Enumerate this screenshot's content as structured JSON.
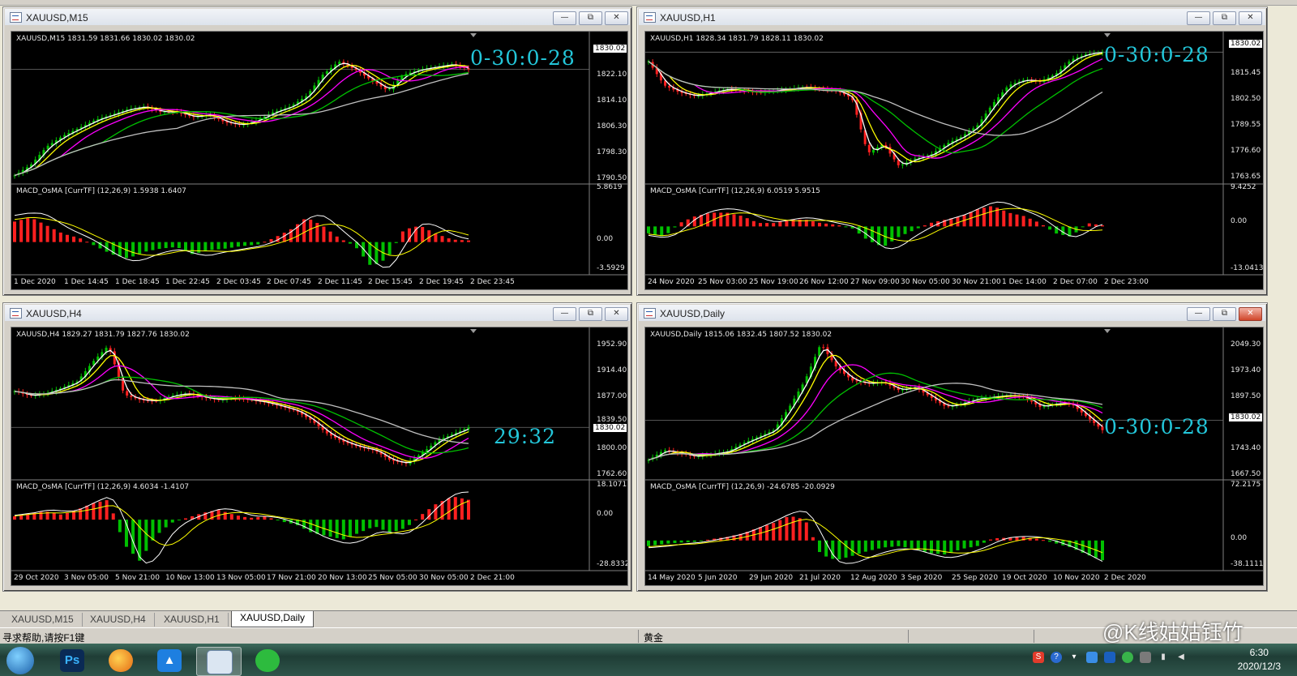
{
  "charts": [
    {
      "title": "XAUUSD,M15",
      "main_info": "XAUUSD,M15  1831.59 1831.66 1830.02 1830.02",
      "macd_info": "MACD_OsMA [CurrTF] (12,26,9) 1.5938 1.6407",
      "current_price": "1830.02",
      "overlay_text": "0-30:0-28",
      "price_ticks": [
        "1822.10",
        "1814.10",
        "1806.30",
        "1798.30",
        "1790.50"
      ],
      "macd_ticks": [
        "5.8619",
        "0.00",
        "-3.5929"
      ],
      "time_ticks": [
        "1 Dec 2020",
        "1 Dec 14:45",
        "1 Dec 18:45",
        "1 Dec 22:45",
        "2 Dec 03:45",
        "2 Dec 07:45",
        "2 Dec 11:45",
        "2 Dec 15:45",
        "2 Dec 19:45",
        "2 Dec 23:45"
      ],
      "price_range": [
        1788,
        1840
      ],
      "price_trend": [
        1790,
        1794,
        1801,
        1805,
        1808,
        1811,
        1813,
        1815,
        1816,
        1814,
        1814,
        1812,
        1813,
        1810,
        1809,
        1811,
        1814,
        1816,
        1820,
        1828,
        1833,
        1830,
        1826,
        1822,
        1828,
        1830,
        1831,
        1832,
        1830
      ],
      "macd_range": [
        -3.6,
        5.9
      ],
      "macd_hist": [
        2.5,
        3,
        2,
        1,
        0.5,
        -0.5,
        -1.5,
        -2,
        -1.2,
        -0.8,
        -0.6,
        -1.5,
        -1,
        -0.8,
        -0.5,
        -0.3,
        0.5,
        1.5,
        3,
        2,
        0.5,
        -0.5,
        -3,
        -2,
        1.5,
        2,
        1,
        0.3,
        0.2
      ]
    },
    {
      "title": "XAUUSD,H1",
      "main_info": "XAUUSD,H1  1828.34 1831.79 1828.11 1830.02",
      "macd_info": "MACD_OsMA [CurrTF] (12,26,9) 6.0519 5.9515",
      "current_price": "1830.02",
      "overlay_text": "0-30:0-28",
      "price_ticks": [
        "1815.45",
        "1802.50",
        "1789.55",
        "1776.60",
        "1763.65"
      ],
      "macd_ticks": [
        "9.4252",
        "0.00",
        "-13.0413"
      ],
      "time_ticks": [
        "24 Nov 2020",
        "25 Nov 03:00",
        "25 Nov 19:00",
        "26 Nov 12:00",
        "27 Nov 09:00",
        "30 Nov 05:00",
        "30 Nov 21:00",
        "1 Dec 14:00",
        "2 Dec 07:00",
        "2 Dec 23:00"
      ],
      "price_range": [
        1760,
        1835
      ],
      "price_trend": [
        1825,
        1812,
        1808,
        1806,
        1808,
        1810,
        1809,
        1808,
        1809,
        1810,
        1811,
        1810,
        1809,
        1805,
        1775,
        1780,
        1768,
        1772,
        1774,
        1780,
        1784,
        1790,
        1802,
        1812,
        1815,
        1814,
        1818,
        1826,
        1829,
        1830
      ],
      "macd_range": [
        -13.1,
        9.5
      ],
      "macd_hist": [
        -2,
        -3,
        1,
        3,
        4,
        4,
        3,
        1,
        1,
        2,
        2,
        1,
        0.5,
        -0.5,
        -4,
        -6,
        -3,
        -1,
        1,
        2,
        3,
        5,
        6,
        4,
        3,
        1,
        -2,
        -3,
        1,
        0.3
      ]
    },
    {
      "title": "XAUUSD,H4",
      "main_info": "XAUUSD,H4  1829.27 1831.79 1827.76 1830.02",
      "macd_info": "MACD_OsMA [CurrTF] (12,26,9) 4.6034 -1.4107",
      "current_price": "1830.02",
      "overlay_text": "29:32",
      "price_ticks": [
        "1952.90",
        "1914.40",
        "1877.00",
        "1839.50",
        "1800.00",
        "1762.60"
      ],
      "macd_ticks": [
        "18.1071",
        "0.00",
        "-28.8332"
      ],
      "time_ticks": [
        "29 Oct 2020",
        "3 Nov 05:00",
        "5 Nov 21:00",
        "10 Nov 13:00",
        "13 Nov 05:00",
        "17 Nov 21:00",
        "20 Nov 13:00",
        "25 Nov 05:00",
        "30 Nov 05:00",
        "2 Dec 21:00"
      ],
      "price_range": [
        1755,
        1965
      ],
      "price_trend": [
        1885,
        1878,
        1882,
        1890,
        1900,
        1930,
        1955,
        1880,
        1872,
        1870,
        1878,
        1882,
        1876,
        1872,
        1875,
        1872,
        1868,
        1862,
        1855,
        1840,
        1820,
        1808,
        1800,
        1795,
        1780,
        1775,
        1790,
        1810,
        1820,
        1830
      ],
      "macd_range": [
        -28.9,
        18.2
      ],
      "macd_hist": [
        2,
        4,
        5,
        3,
        6,
        10,
        12,
        -15,
        -25,
        -10,
        -2,
        1,
        4,
        6,
        3,
        1,
        2,
        -1,
        -3,
        -8,
        -10,
        -12,
        -8,
        -4,
        -8,
        -5,
        3,
        10,
        14,
        12
      ]
    },
    {
      "title": "XAUUSD,Daily",
      "main_info": "XAUUSD,Daily  1815.06 1832.45 1807.52 1830.02",
      "macd_info": "MACD_OsMA [CurrTF] (12,26,9) -24.6785 -20.0929",
      "current_price": "1830.02",
      "overlay_text": "0-30:0-28",
      "price_ticks": [
        "2049.30",
        "1973.40",
        "1897.50",
        "1830.02",
        "1743.40",
        "1667.50"
      ],
      "macd_ticks": [
        "72.2175",
        "0.00",
        "-38.1111"
      ],
      "time_ticks": [
        "14 May 2020",
        "5 Jun 2020",
        "29 Jun 2020",
        "21 Jul 2020",
        "12 Aug 2020",
        "3 Sep 2020",
        "25 Sep 2020",
        "19 Oct 2020",
        "10 Nov 2020",
        "2 Dec 2020"
      ],
      "price_range": [
        1660,
        2075
      ],
      "price_trend": [
        1710,
        1740,
        1730,
        1720,
        1728,
        1735,
        1760,
        1780,
        1800,
        1870,
        1950,
        2060,
        1990,
        1950,
        1940,
        1945,
        1920,
        1930,
        1900,
        1870,
        1880,
        1895,
        1900,
        1905,
        1900,
        1870,
        1880,
        1880,
        1840,
        1800
      ],
      "macd_range": [
        -38.2,
        72.3
      ],
      "macd_hist": [
        -8,
        -5,
        -3,
        -2,
        2,
        5,
        10,
        18,
        25,
        35,
        30,
        -20,
        -28,
        -22,
        -15,
        -10,
        -8,
        -12,
        -18,
        -20,
        -12,
        -8,
        3,
        4,
        5,
        2,
        -4,
        -10,
        -20,
        -28
      ]
    }
  ],
  "tabs": [
    "XAUUSD,M15",
    "XAUUSD,H4",
    "XAUUSD,H1",
    "XAUUSD,Daily"
  ],
  "active_tab": "XAUUSD,Daily",
  "status": {
    "help_text": "寻求帮助,请按F1键",
    "symbol_label": "黄金"
  },
  "taskbar": {
    "time": "6:30",
    "date": "2020/12/3",
    "ps_label": "Ps"
  },
  "watermark": "@K线姑姑钰竹",
  "window_buttons": {
    "minimize": "—",
    "restore": "⧉",
    "close": "✕"
  },
  "colors": {
    "bull": "#00c000",
    "bear": "#ff2020",
    "ma_fast": "#ffffff",
    "ma_yellow": "#ffff00",
    "ma_magenta": "#ff00ff",
    "ma_green": "#00c000",
    "ma_gray": "#c0c0c0",
    "overlay": "#23c6d9"
  }
}
